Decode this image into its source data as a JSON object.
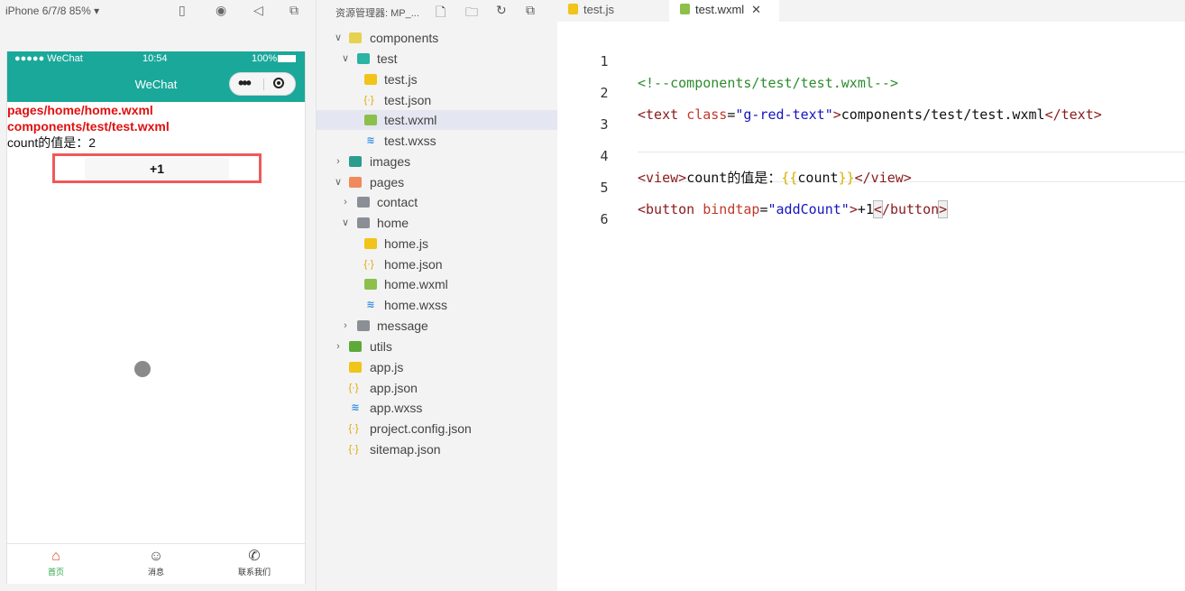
{
  "simulator": {
    "device_label": "iPhone 6/7/8 85% ▾",
    "status": {
      "carrier": "●●●●● WeChat",
      "time": "10:54",
      "battery": "100%"
    },
    "nav_title": "WeChat",
    "lines": {
      "home_path": "pages/home/home.wxml",
      "component_path": "components/test/test.wxml",
      "count_text": "count的值是：2"
    },
    "button_label": "+1",
    "tabbar": [
      {
        "label": "首页",
        "icon": "home-icon"
      },
      {
        "label": "消息",
        "icon": "message-icon"
      },
      {
        "label": "联系我们",
        "icon": "phone-icon"
      }
    ]
  },
  "explorer": {
    "title": "资源管理器: MP_...",
    "tree": [
      {
        "label": "components"
      },
      {
        "label": "test"
      },
      {
        "label": "test.js"
      },
      {
        "label": "test.json"
      },
      {
        "label": "test.wxml"
      },
      {
        "label": "test.wxss"
      },
      {
        "label": "images"
      },
      {
        "label": "pages"
      },
      {
        "label": "contact"
      },
      {
        "label": "home"
      },
      {
        "label": "home.js"
      },
      {
        "label": "home.json"
      },
      {
        "label": "home.wxml"
      },
      {
        "label": "home.wxss"
      },
      {
        "label": "message"
      },
      {
        "label": "utils"
      },
      {
        "label": "app.js"
      },
      {
        "label": "app.json"
      },
      {
        "label": "app.wxss"
      },
      {
        "label": "project.config.json"
      },
      {
        "label": "sitemap.json"
      }
    ]
  },
  "editor": {
    "tabs": [
      {
        "label": "test.js"
      },
      {
        "label": "test.wxml",
        "close": "✕"
      }
    ],
    "line_numbers": [
      "1",
      "2",
      "3",
      "4",
      "5",
      "6"
    ],
    "code": {
      "l1": "<!--components/test/test.wxml-->",
      "l2": {
        "open": "<text ",
        "attr": "class",
        "eq": "=",
        "str": "\"g-red-text\"",
        "gt": ">",
        "text": "components/test/test.wxml",
        "close": "</text>"
      },
      "l4": {
        "open": "<view>",
        "text": "count的值是：",
        "brace_open": "{{",
        "var": "count",
        "brace_close": "}}",
        "close": "</view>"
      },
      "l5": {
        "open": "<button ",
        "attr": "bindtap",
        "eq": "=",
        "str": "\"addCount\"",
        "gt": ">",
        "text": "+1",
        "close_lt": "<",
        "close_rest": "/button",
        "close_gt": ">"
      }
    }
  },
  "colors": {
    "nav_bg": "#1aa89a",
    "red_text": "#e01010",
    "highlight_box": "#ee5a5a"
  }
}
